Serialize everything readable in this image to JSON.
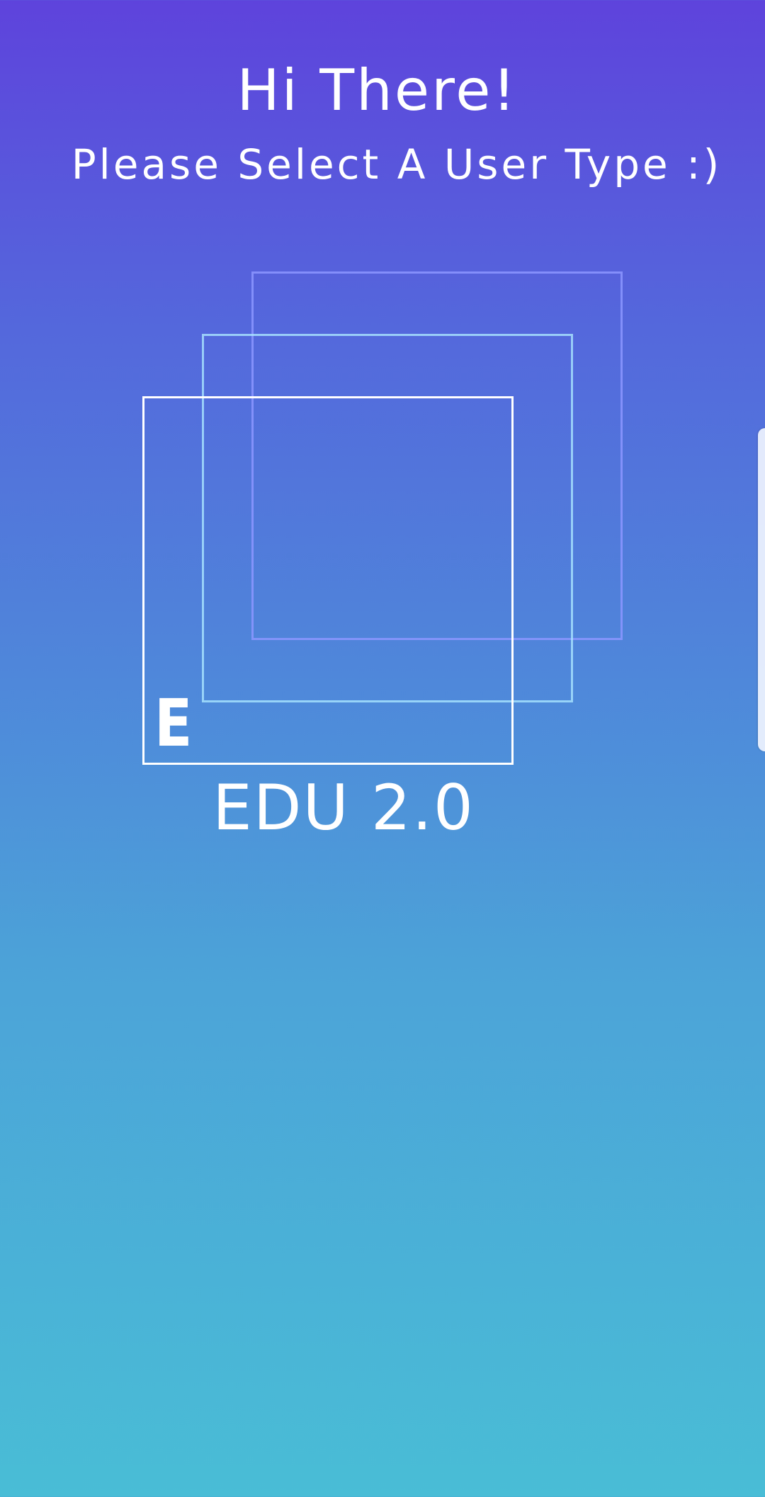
{
  "header": {
    "greeting": "Hi There!",
    "subtitle": "Please Select A User Type :)"
  },
  "logo": {
    "letter": "E",
    "app_name": "EDU 2.0"
  },
  "colors": {
    "gradient_top": "#5e43dc",
    "gradient_bottom": "#49bdd6",
    "text": "#ffffff"
  }
}
